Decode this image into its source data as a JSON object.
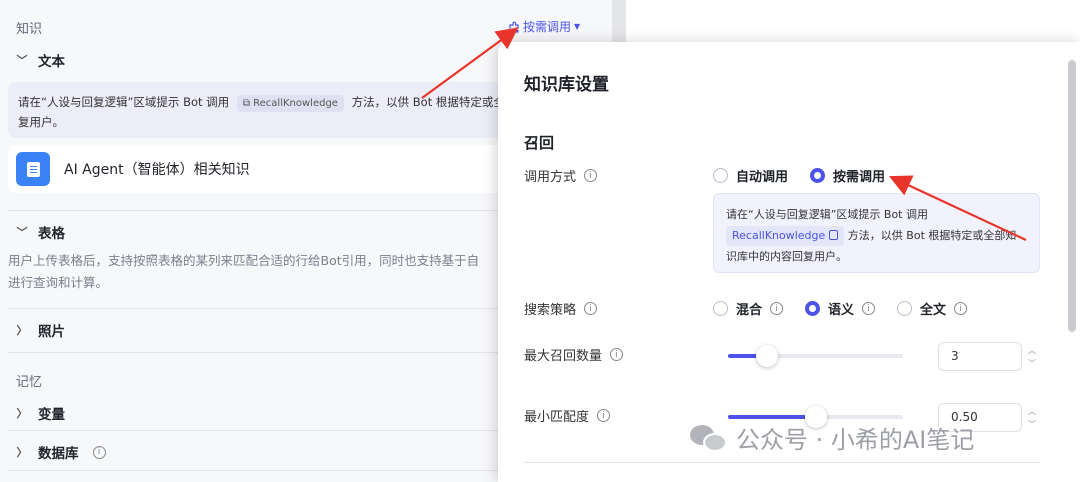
{
  "left": {
    "knowledge_title": "知识",
    "on_demand_link": "按需调用",
    "text_group": "文本",
    "hint_prefix": "请在“人设与回复逻辑”区域提示 Bot 调用",
    "hint_chip": "RecallKnowledge",
    "hint_suffix": "方法，以供 Bot 根据特定或全部",
    "hint_line2": "复用户。",
    "knowledge_item": "AI Agent（智能体）相关知识",
    "table_group": "表格",
    "table_desc_line1": "用户上传表格后，支持按照表格的某列来匹配合适的行给Bot引用，同时也支持基于自",
    "table_desc_line2": "进行查询和计算。",
    "photo_group": "照片",
    "memory_title": "记忆",
    "variable_group": "变量",
    "database_group": "数据库"
  },
  "modal": {
    "title": "知识库设置",
    "section": "召回",
    "call_mode_label": "调用方式",
    "call_mode_options": [
      "自动调用",
      "按需调用"
    ],
    "call_mode_selected": "按需调用",
    "hint_prefix": "请在“人设与回复逻辑”区域提示 Bot 调用",
    "hint_chip": "RecallKnowledge",
    "hint_suffix": "方法，以供 Bot 根据特定或全部知",
    "hint_line3": "识库中的内容回复用户。",
    "search_label": "搜索策略",
    "search_options": [
      "混合",
      "语义",
      "全文"
    ],
    "search_selected": "语义",
    "max_recall_label": "最大召回数量",
    "max_recall_value": "3",
    "max_recall_fraction": 0.22,
    "min_match_label": "最小匹配度",
    "min_match_value": "0.50",
    "min_match_fraction": 0.5
  },
  "watermark": "公众号 · 小希的AI笔记",
  "colors": {
    "accent": "#4d53e8",
    "arrow": "#e8342b"
  }
}
